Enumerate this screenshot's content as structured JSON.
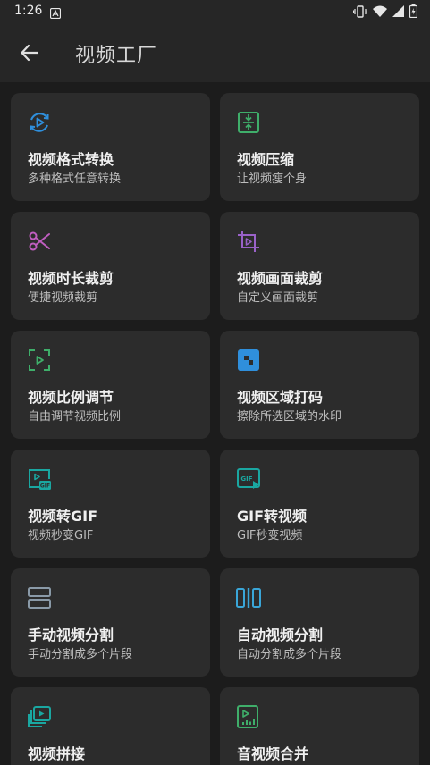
{
  "status_bar": {
    "time": "1:26"
  },
  "app_bar": {
    "title": "视频工厂"
  },
  "cards": [
    {
      "title": "视频格式转换",
      "desc": "多种格式任意转换",
      "icon": "convert-icon",
      "color": "#2f8fdc"
    },
    {
      "title": "视频压缩",
      "desc": "让视频瘦个身",
      "icon": "compress-icon",
      "color": "#3fae6a"
    },
    {
      "title": "视频时长裁剪",
      "desc": "便捷视频裁剪",
      "icon": "scissors-icon",
      "color": "#c05ec0"
    },
    {
      "title": "视频画面裁剪",
      "desc": "自定义画面裁剪",
      "icon": "crop-icon",
      "color": "#9a62c9"
    },
    {
      "title": "视频比例调节",
      "desc": "自由调节视频比例",
      "icon": "ratio-icon",
      "color": "#3fae6a"
    },
    {
      "title": "视频区域打码",
      "desc": "擦除所选区域的水印",
      "icon": "mosaic-icon",
      "color": "#2f8fdc"
    },
    {
      "title": "视频转GIF",
      "desc": "视频秒变GIF",
      "icon": "video-to-gif-icon",
      "color": "#1aa7a1"
    },
    {
      "title": "GIF转视频",
      "desc": "GIF秒变视频",
      "icon": "gif-to-video-icon",
      "color": "#1aa7a1"
    },
    {
      "title": "手动视频分割",
      "desc": "手动分割成多个片段",
      "icon": "split-manual-icon",
      "color": "#8a9aa8"
    },
    {
      "title": "自动视频分割",
      "desc": "自动分割成多个片段",
      "icon": "split-auto-icon",
      "color": "#3aa6d8"
    },
    {
      "title": "视频拼接",
      "desc": "",
      "icon": "stack-icon",
      "color": "#1aa7a1"
    },
    {
      "title": "音视频合并",
      "desc": "",
      "icon": "audio-video-icon",
      "color": "#3fae6a"
    }
  ]
}
